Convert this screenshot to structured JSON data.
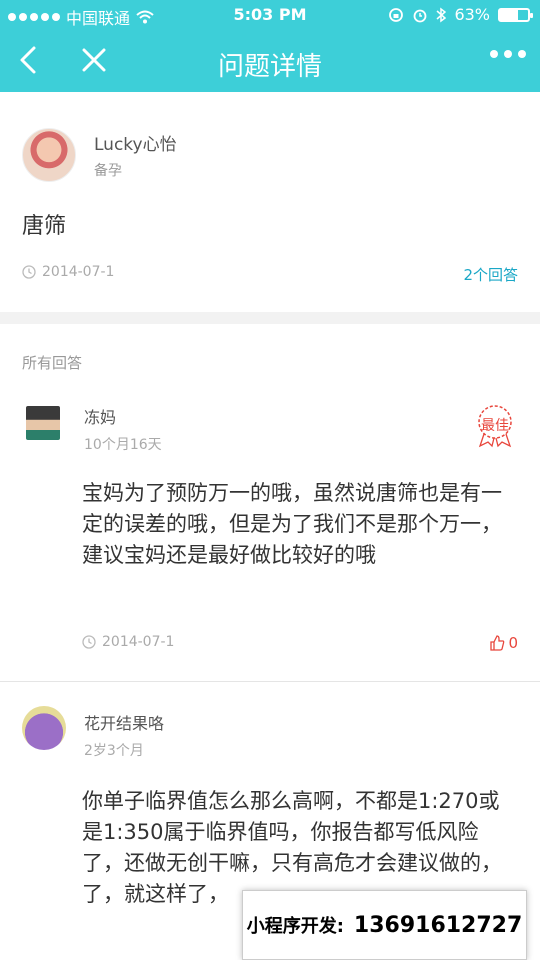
{
  "status_bar": {
    "carrier": "中国联通",
    "time": "5:03 PM",
    "battery": "63%",
    "battery_level": 0.63,
    "icons": [
      "signal-dots-icon",
      "wifi-icon",
      "rotation-lock-icon",
      "alarm-icon",
      "bluetooth-icon",
      "battery-icon"
    ]
  },
  "navbar": {
    "title": "问题详情",
    "back_icon": "chevron-left-icon",
    "close_icon": "close-icon",
    "more_icon": "more-dots-icon"
  },
  "question": {
    "user": "Lucky心怡",
    "tag": "备孕",
    "title": "唐筛",
    "date": "2014-07-1",
    "answer_count": "2个回答"
  },
  "answers_section": {
    "label": "所有回答"
  },
  "answers": [
    {
      "user": "冻妈",
      "time": "10个月16天",
      "badge": "最佳",
      "body": "宝妈为了预防万一的哦，虽然说唐筛也是有一定的误差的哦，但是为了我们不是那个万一，建议宝妈还是最好做比较好的哦",
      "date": "2014-07-1",
      "likes": "0"
    },
    {
      "user": "花开结果咯",
      "time": "2岁3个月",
      "body": "你单子临界值怎么那么高啊，不都是1:270或是1:350属于临界值吗，你报告都写低风险了，还做无创干嘛，只有高危才会建议做的，了，就这样了，"
    }
  ],
  "promo": {
    "label": "小程序开发:",
    "phone": "13691612727"
  },
  "colors": {
    "accent": "#3dcfd8",
    "link": "#1aa7c6",
    "highlight": "#e8463c"
  }
}
